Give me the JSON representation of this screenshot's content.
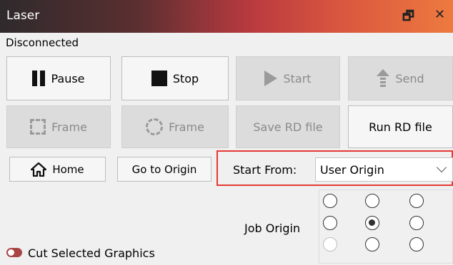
{
  "titlebar": {
    "title": "Laser",
    "float_glyph": "🗗",
    "close_glyph": "✕"
  },
  "status": "Disconnected",
  "buttons": {
    "pause": "Pause",
    "stop": "Stop",
    "start": "Start",
    "send": "Send",
    "frame_square": "Frame",
    "frame_circle": "Frame",
    "save_rd": "Save RD file",
    "run_rd": "Run RD file",
    "home": "Home",
    "go_origin": "Go to Origin"
  },
  "start_from": {
    "label": "Start From:",
    "value": "User Origin"
  },
  "job_origin": {
    "label": "Job Origin",
    "selected_index": 4
  },
  "cut_selected": {
    "label": "Cut Selected Graphics",
    "on": true
  },
  "colors": {
    "accent": "#b83a3f",
    "highlight": "#e53935"
  }
}
